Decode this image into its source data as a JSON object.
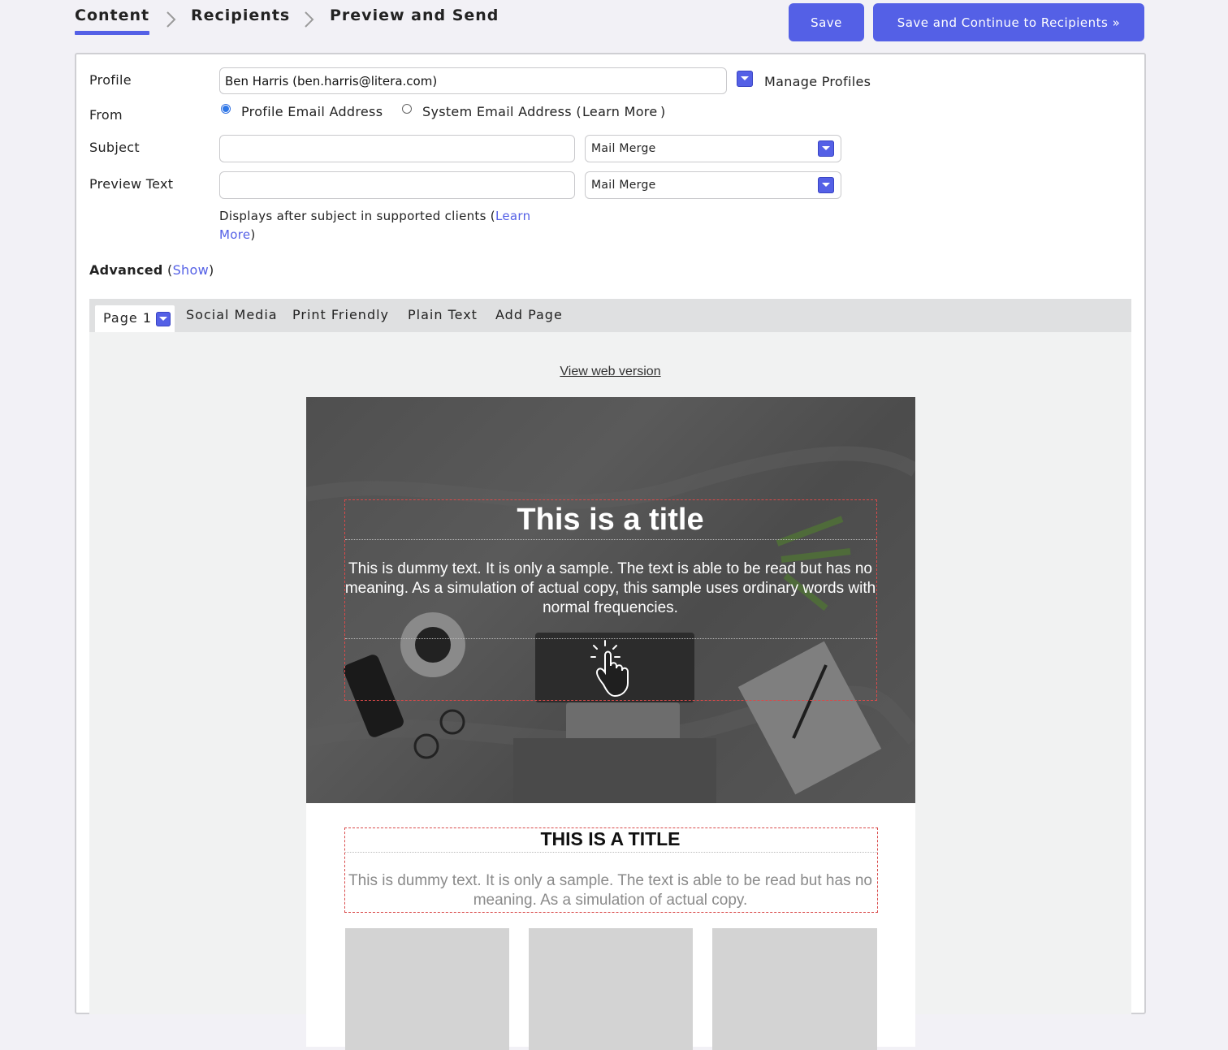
{
  "wizard": {
    "steps": [
      "Content",
      "Recipients",
      "Preview and Send"
    ],
    "active_step": "Content",
    "save_label": "Save",
    "save_continue_label": "Save and Continue to Recipients »"
  },
  "form": {
    "profile_label": "Profile",
    "profile_value": "Ben Harris (ben.harris@litera.com)",
    "manage_profiles_label": "Manage Profiles",
    "from_label": "From",
    "from_option_profile": "Profile Email Address",
    "from_option_system": "System Email Address (",
    "from_learn_more": "Learn More",
    "from_close_paren": ")",
    "from_selected": "Profile Email Address",
    "subject_label": "Subject",
    "subject_value": "",
    "subject_merge": "Mail Merge",
    "preview_label": "Preview Text",
    "preview_value": "",
    "preview_merge": "Mail Merge",
    "preview_help_prefix": "Displays after subject in supported clients (",
    "preview_help_learn": "Learn",
    "preview_help_more": "More",
    "preview_help_suffix": ")",
    "advanced_label": "Advanced",
    "advanced_open": "(",
    "advanced_show": "Show",
    "advanced_close": ")"
  },
  "tabs": {
    "page1": "Page 1",
    "social": "Social Media",
    "print": "Print Friendly",
    "plain": "Plain Text",
    "add": "Add Page"
  },
  "email": {
    "view_web": "View web version",
    "hero_title": "This is a title",
    "hero_text": "This is dummy text. It is only a sample. The text is able to be read but has no meaning. As a simulation of actual copy, this sample uses ordinary words with normal frequencies.",
    "section_title": "THIS IS A TITLE",
    "section_text": "This is dummy text. It is only a sample. The text is able to be read but has no meaning. As a simulation of actual copy."
  },
  "colors": {
    "accent": "#5460e6",
    "page_bg": "#f2f1f6",
    "selection_border": "#d94a4a"
  }
}
